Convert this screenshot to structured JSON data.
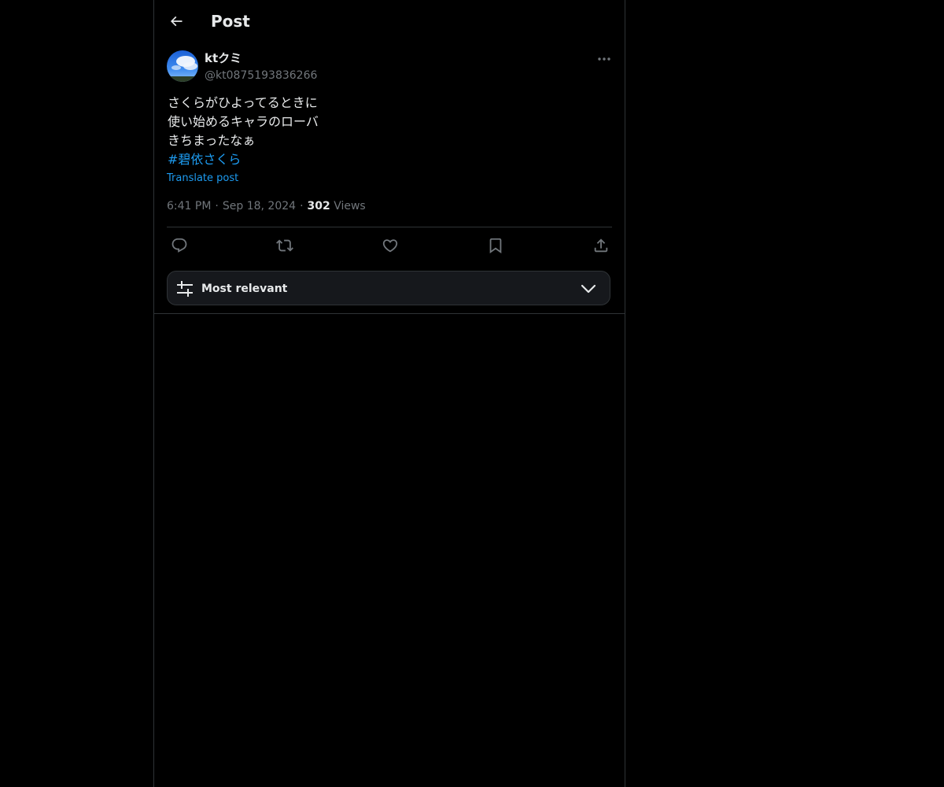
{
  "header": {
    "title": "Post",
    "back_icon": "arrow-left-icon"
  },
  "author": {
    "display_name": "ktクミ",
    "handle": "@kt0875193836266",
    "avatar_icon": "avatar-sky-image"
  },
  "post": {
    "lines": [
      "さくらがひよってるときに",
      "使い始めるキャラのローバ",
      "きちまったなぁ"
    ],
    "hashtag": "#碧依さくら",
    "translate_label": "Translate post"
  },
  "meta": {
    "time": "6:41 PM",
    "date": "Sep 18, 2024",
    "separator": "·",
    "views_count": "302",
    "views_label": "Views"
  },
  "actions": [
    {
      "name": "reply",
      "icon": "reply-icon"
    },
    {
      "name": "repost",
      "icon": "repost-icon"
    },
    {
      "name": "like",
      "icon": "heart-icon"
    },
    {
      "name": "bookmark",
      "icon": "bookmark-icon"
    },
    {
      "name": "share",
      "icon": "share-icon"
    }
  ],
  "sort": {
    "label": "Most relevant",
    "icon": "sliders-icon",
    "chevron_icon": "chevron-down-icon"
  },
  "colors": {
    "background": "#000000",
    "text": "#e7e9ea",
    "muted": "#71767b",
    "accent": "#1d9bf0",
    "border": "#2f3336"
  }
}
